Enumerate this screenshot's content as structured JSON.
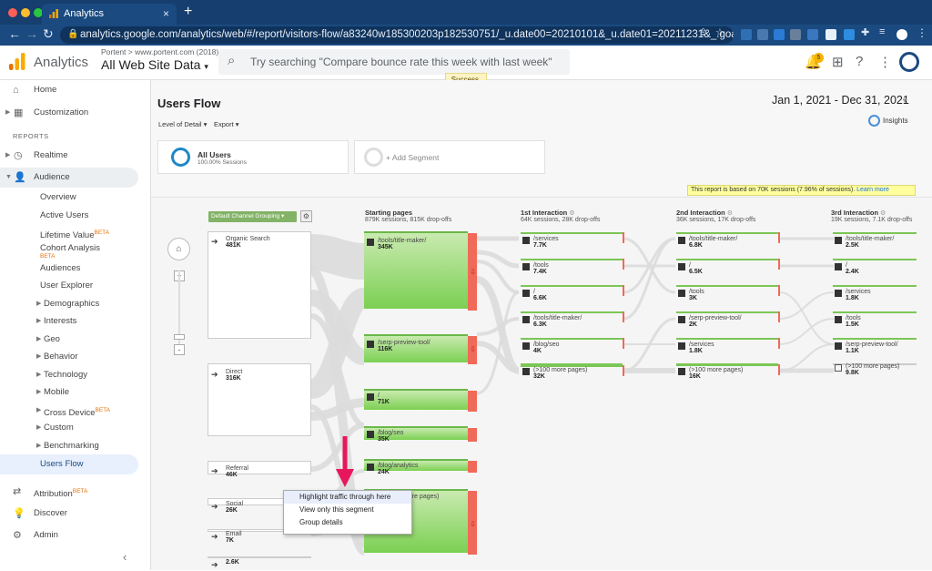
{
  "browser": {
    "tab_title": "Analytics",
    "url": "analytics.google.com/analytics/web/#/report/visitors-flow/a83240w185300203p182530751/_u.date00=20210101&_u.date01=20211231&_.goalOption=1&_r.dimension...",
    "new_tab": "+",
    "close": "×"
  },
  "header": {
    "brand": "Analytics",
    "account": "Portent > www.portent.com (2018)",
    "property": "All Web Site Data",
    "search_placeholder": "Try searching \"Compare bounce rate this week with last week\"",
    "notifications_count": "5",
    "toast": "Success."
  },
  "sidebar": {
    "reports_heading": "REPORTS",
    "items": [
      {
        "label": "Home"
      },
      {
        "label": "Customization"
      },
      {
        "label": "Realtime"
      },
      {
        "label": "Audience"
      },
      {
        "label": "Overview"
      },
      {
        "label": "Active Users"
      },
      {
        "label": "Lifetime Value",
        "beta": "BETA"
      },
      {
        "label": "Cohort Analysis",
        "beta": "BETA"
      },
      {
        "label": "Audiences"
      },
      {
        "label": "User Explorer"
      },
      {
        "label": "Demographics"
      },
      {
        "label": "Interests"
      },
      {
        "label": "Geo"
      },
      {
        "label": "Behavior"
      },
      {
        "label": "Technology"
      },
      {
        "label": "Mobile"
      },
      {
        "label": "Cross Device",
        "beta": "BETA"
      },
      {
        "label": "Custom"
      },
      {
        "label": "Benchmarking"
      },
      {
        "label": "Users Flow"
      },
      {
        "label": "Attribution",
        "beta": "BETA"
      },
      {
        "label": "Discover"
      },
      {
        "label": "Admin"
      }
    ]
  },
  "report": {
    "title": "Users Flow",
    "date_range": "Jan 1, 2021 - Dec 31, 2021",
    "level_of_detail": "Level of Detail",
    "export": "Export",
    "insights": "Insights",
    "segment_all": "All Users",
    "segment_all_sub": "100.00% Sessions",
    "add_segment": "+ Add Segment",
    "note": "This report is based on 70K sessions (7.96% of sessions).",
    "note_link": "Learn more",
    "dimension": "Default Channel Grouping"
  },
  "columns": [
    {
      "title": "Starting pages",
      "sub": "879K sessions, 815K drop-offs"
    },
    {
      "title": "1st Interaction",
      "sub": "64K sessions, 28K drop-offs"
    },
    {
      "title": "2nd Interaction",
      "sub": "36K sessions, 17K drop-offs"
    },
    {
      "title": "3rd Interaction",
      "sub": "19K sessions, 7.1K drop-offs"
    }
  ],
  "sources": [
    {
      "name": "Organic Search",
      "value": "481K"
    },
    {
      "name": "Direct",
      "value": "316K"
    },
    {
      "name": "Referral",
      "value": "46K"
    },
    {
      "name": "Social",
      "value": "26K"
    },
    {
      "name": "Email",
      "value": "7K"
    },
    {
      "name": "",
      "value": "2.6K"
    }
  ],
  "starting_pages": [
    {
      "name": "/tools/title-maker/",
      "value": "345K"
    },
    {
      "name": "/serp-preview-tool/",
      "value": "116K"
    },
    {
      "name": "/",
      "value": "71K"
    },
    {
      "name": "/blog/seo",
      "value": "35K"
    },
    {
      "name": "/blog/analytics",
      "value": "24K"
    },
    {
      "name": "(>100 more pages)",
      "value": ""
    }
  ],
  "interaction1": [
    {
      "name": "/services",
      "value": "7.7K"
    },
    {
      "name": "/tools",
      "value": "7.4K"
    },
    {
      "name": "/",
      "value": "6.6K"
    },
    {
      "name": "/tools/title-maker/",
      "value": "6.3K"
    },
    {
      "name": "/blog/seo",
      "value": "4K"
    },
    {
      "name": "(>100 more pages)",
      "value": "32K"
    }
  ],
  "interaction2": [
    {
      "name": "/tools/title-maker/",
      "value": "6.8K"
    },
    {
      "name": "/",
      "value": "6.5K"
    },
    {
      "name": "/tools",
      "value": "3K"
    },
    {
      "name": "/serp-preview-tool/",
      "value": "2K"
    },
    {
      "name": "/services",
      "value": "1.8K"
    },
    {
      "name": "(>100 more pages)",
      "value": "16K"
    }
  ],
  "interaction3": [
    {
      "name": "/tools/title-maker/",
      "value": "2.5K"
    },
    {
      "name": "/",
      "value": "2.4K"
    },
    {
      "name": "/services",
      "value": "1.8K"
    },
    {
      "name": "/tools",
      "value": "1.5K"
    },
    {
      "name": "/serp-preview-tool/",
      "value": "1.1K"
    },
    {
      "name": "(>100 more pages)",
      "value": "9.8K"
    }
  ],
  "context_menu": [
    "Highlight traffic through here",
    "View only this segment",
    "Group details"
  ],
  "colors": {
    "accent": "#1a73e8",
    "flow_green": "#7bd052",
    "dropoff_red": "#f06a5a",
    "annotation_arrow": "#e8175d"
  }
}
